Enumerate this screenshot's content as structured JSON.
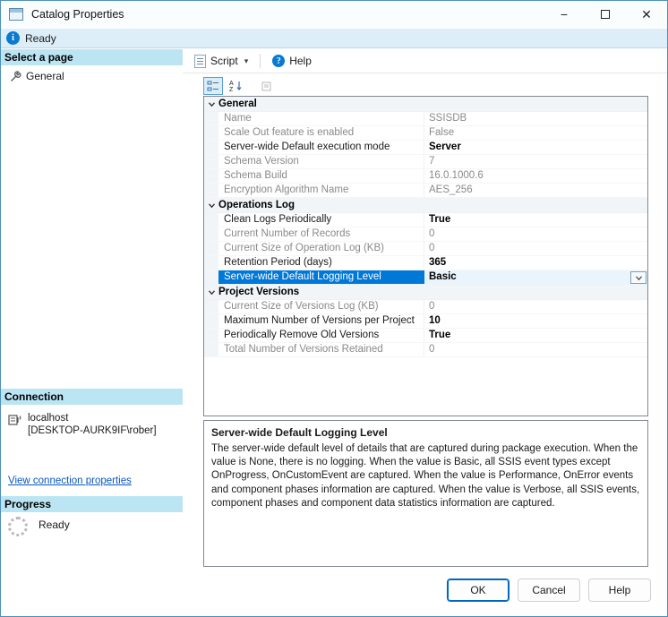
{
  "window": {
    "title": "Catalog Properties",
    "status": "Ready",
    "controls": {
      "minimize": "−",
      "close": "✕"
    }
  },
  "toolbar": {
    "script_label": "Script",
    "help_label": "Help"
  },
  "sidebar": {
    "select_page_header": "Select a page",
    "pages": [
      {
        "label": "General"
      }
    ],
    "connection_header": "Connection",
    "connection_server": "localhost",
    "connection_user": "[DESKTOP-AURK9IF\\rober]",
    "connection_link": "View connection properties",
    "progress_header": "Progress",
    "progress_status": "Ready"
  },
  "property_grid": {
    "categories": [
      {
        "name": "General",
        "rows": [
          {
            "label": "Name",
            "value": "SSISDB",
            "disabled": true
          },
          {
            "label": "Scale Out feature is enabled",
            "value": "False",
            "disabled": true
          },
          {
            "label": "Server-wide Default execution mode",
            "value": "Server"
          },
          {
            "label": "Schema Version",
            "value": "7",
            "disabled": true
          },
          {
            "label": "Schema Build",
            "value": "16.0.1000.6",
            "disabled": true
          },
          {
            "label": "Encryption Algorithm Name",
            "value": "AES_256",
            "disabled": true
          }
        ]
      },
      {
        "name": "Operations Log",
        "rows": [
          {
            "label": "Clean Logs Periodically",
            "value": "True"
          },
          {
            "label": "Current Number of Records",
            "value": "0",
            "disabled": true
          },
          {
            "label": "Current Size of Operation Log (KB)",
            "value": "0",
            "disabled": true
          },
          {
            "label": "Retention Period (days)",
            "value": "365"
          },
          {
            "label": "Server-wide Default Logging Level",
            "value": "Basic",
            "selected": true
          }
        ]
      },
      {
        "name": "Project Versions",
        "rows": [
          {
            "label": "Current Size of Versions Log (KB)",
            "value": "0",
            "disabled": true
          },
          {
            "label": "Maximum Number of Versions per Project",
            "value": "10"
          },
          {
            "label": "Periodically Remove Old Versions",
            "value": "True"
          },
          {
            "label": "Total Number of Versions Retained",
            "value": "0",
            "disabled": true
          }
        ]
      }
    ]
  },
  "description": {
    "title": "Server-wide Default Logging Level",
    "text": "The server-wide default level of details that are captured during package execution. When the value is None, there is no logging. When the value is Basic, all SSIS event types except OnProgress, OnCustomEvent are captured. When the value is Performance, OnError events and component phases information are captured. When the value is Verbose, all SSIS events, component phases and component data statistics information are captured."
  },
  "footer": {
    "ok_label": "OK",
    "cancel_label": "Cancel",
    "help_label": "Help"
  },
  "colors": {
    "accent_selection": "#0078d7",
    "sidebar_header": "#bce5f4",
    "status_strip": "#ddeef9",
    "link": "#0757bd"
  }
}
